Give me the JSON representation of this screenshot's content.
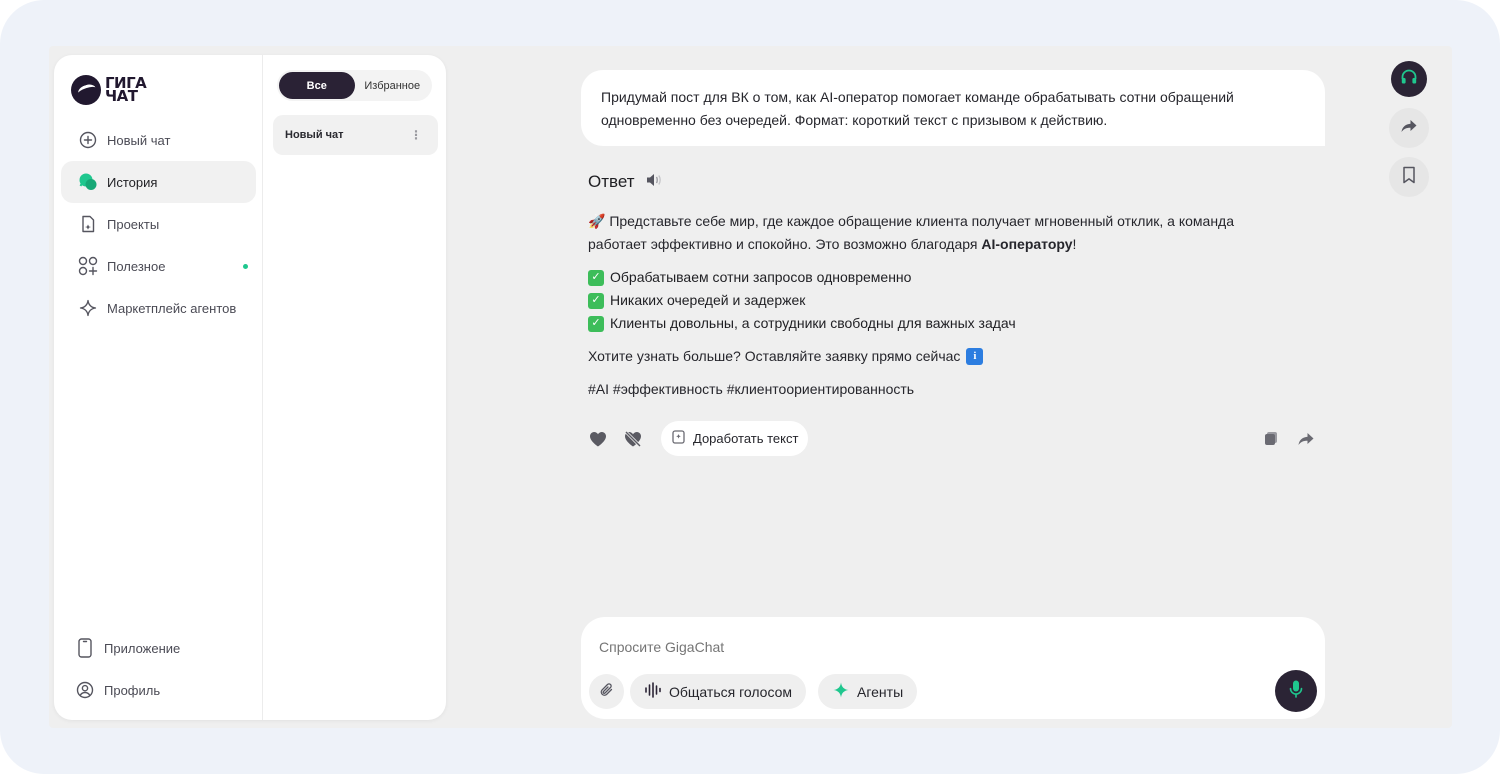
{
  "brand": {
    "line1": "ГИГА",
    "line2": "ЧАТ"
  },
  "nav": {
    "items": [
      {
        "label": "Новый чат",
        "icon": "plus-circle-icon"
      },
      {
        "label": "История",
        "icon": "chat-bubbles-icon"
      },
      {
        "label": "Проекты",
        "icon": "project-file-icon"
      },
      {
        "label": "Полезное",
        "icon": "apps-grid-icon"
      },
      {
        "label": "Маркетплейс агентов",
        "icon": "sparkle-icon"
      }
    ],
    "bottom": [
      {
        "label": "Приложение",
        "icon": "phone-icon"
      },
      {
        "label": "Профиль",
        "icon": "profile-icon"
      }
    ]
  },
  "history": {
    "tabs": [
      "Все",
      "Избранное"
    ],
    "chats": [
      {
        "title": "Новый чат"
      }
    ]
  },
  "conversation": {
    "user_message": "Придумай пост для ВК о том, как AI-оператор помогает команде обрабатывать сотни обращений одновременно без очередей. Формат: короткий текст с призывом к действию.",
    "answer_title": "Ответ",
    "intro_emoji": "🚀",
    "intro_text": "Представьте себе мир, где каждое обращение клиента получает мгновенный отклик, а команда работает эффективно и спокойно. Это возможно благодаря",
    "intro_bold": "AI-оператору",
    "intro_end": "!",
    "bullets": [
      "Обрабатываем сотни запросов одновременно",
      "Никаких очередей и задержек",
      "Клиенты довольны, а сотрудники свободны для важных задач"
    ],
    "cta": "Хотите узнать больше? Оставляйте заявку прямо сейчас",
    "cta_badge": "i",
    "hashtags": "#AI #эффективность #клиентоориентированность",
    "improve_label": "Доработать текст"
  },
  "composer": {
    "placeholder": "Спросите GigaChat",
    "voice_label": "Общаться голосом",
    "agents_label": "Агенты"
  },
  "colors": {
    "accent_dark": "#2b2435",
    "accent_green": "#1fc78e",
    "check_green": "#3dbd5a",
    "info_blue": "#2c7de0"
  }
}
